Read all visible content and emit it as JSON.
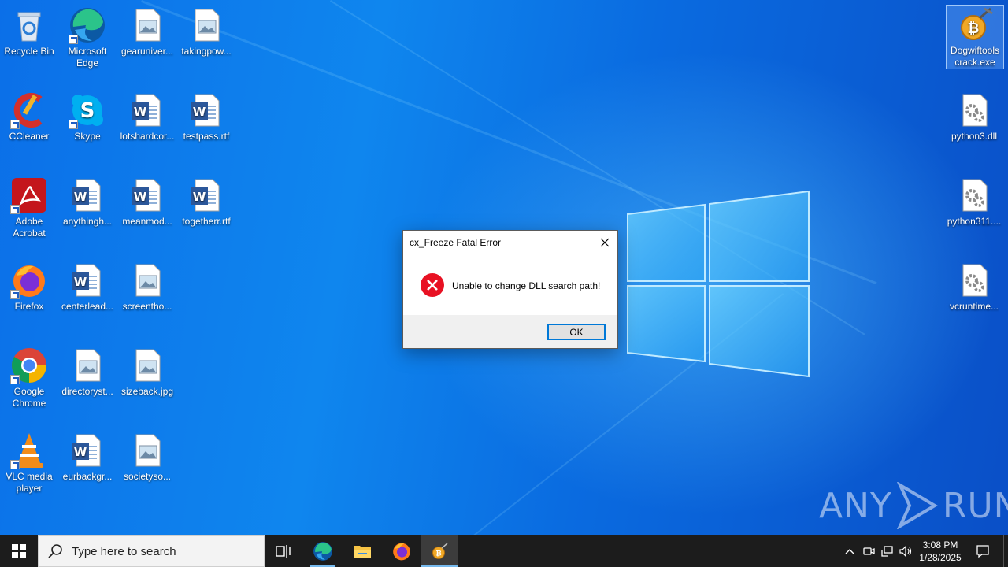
{
  "desktop": {
    "icons": [
      {
        "label": "Recycle Bin",
        "icon": "recycle-bin-icon"
      },
      {
        "label": "Microsoft Edge",
        "icon": "edge-icon"
      },
      {
        "label": "gearuniver...",
        "icon": "image-file-icon"
      },
      {
        "label": "takingpow...",
        "icon": "image-file-icon"
      },
      {
        "label": "CCleaner",
        "icon": "ccleaner-icon"
      },
      {
        "label": "Skype",
        "icon": "skype-icon"
      },
      {
        "label": "lotshardcor...",
        "icon": "word-document-icon"
      },
      {
        "label": "testpass.rtf",
        "icon": "word-document-icon"
      },
      {
        "label": "Adobe Acrobat",
        "icon": "acrobat-icon"
      },
      {
        "label": "anythingh...",
        "icon": "word-document-icon"
      },
      {
        "label": "meanmod...",
        "icon": "word-document-icon"
      },
      {
        "label": "togetherr.rtf",
        "icon": "word-document-icon"
      },
      {
        "label": "Firefox",
        "icon": "firefox-icon"
      },
      {
        "label": "centerlead...",
        "icon": "word-document-icon"
      },
      {
        "label": "screentho...",
        "icon": "image-file-icon"
      },
      {
        "label": "Google Chrome",
        "icon": "chrome-icon"
      },
      {
        "label": "directoryst...",
        "icon": "image-file-icon"
      },
      {
        "label": "sizeback.jpg",
        "icon": "image-file-icon"
      },
      {
        "label": "VLC media player",
        "icon": "vlc-icon"
      },
      {
        "label": "eurbackgr...",
        "icon": "word-document-icon"
      },
      {
        "label": "societyso...",
        "icon": "image-file-icon"
      },
      {
        "label": "Dogwiftools crack.exe",
        "icon": "dogwiftools-exe-icon"
      },
      {
        "label": "python3.dll",
        "icon": "dll-file-icon"
      },
      {
        "label": "python311....",
        "icon": "dll-file-icon"
      },
      {
        "label": "vcruntime...",
        "icon": "dll-file-icon"
      }
    ]
  },
  "dialog": {
    "title": "cx_Freeze Fatal Error",
    "message": "Unable to change DLL search path!",
    "ok_label": "OK"
  },
  "watermark": {
    "left": "ANY",
    "right": "RUN"
  },
  "taskbar": {
    "search_placeholder": "Type here to search",
    "time": "3:08 PM",
    "date": "1/28/2025"
  },
  "colors": {
    "accent": "#0078d7",
    "error": "#e81123",
    "taskbar": "#1c1c1c"
  }
}
